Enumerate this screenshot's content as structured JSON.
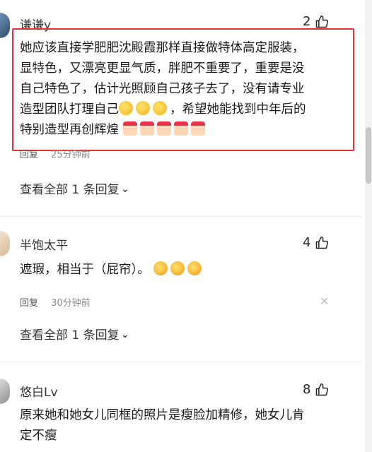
{
  "comments": [
    {
      "username": "谦谦y",
      "likes": "2",
      "text_lines": [
        "她应该直接学肥肥沈殿霞那样直接做特体高定服装，",
        "显特色，又漂亮更显气质，胖肥不重要了，重要是没",
        "自己特色了，估计光照顾自己孩子去了，没有请专业",
        "造型团队打理自己",
        "，希望她能找到中年后的",
        "特别造型再创辉煌"
      ],
      "reply_label": "回复",
      "time": "25分钟前",
      "view_all": "查看全部 1 条回复"
    },
    {
      "username": "半饱太平",
      "likes": "4",
      "text": "遮瑕，相当于（屁帘）。",
      "reply_label": "回复",
      "time": "30分钟前",
      "view_all": "查看全部 1 条回复"
    },
    {
      "username": "悠白Lv",
      "likes": "8",
      "text_lines": [
        "原来她和她女儿同框的照片是瘦脸加精修，她女儿肯",
        "定不瘦"
      ]
    }
  ],
  "icons": {
    "like": "thumbs-up-icon",
    "chevron": "chevron-down-icon",
    "close": "close-icon",
    "emoji_smirk": "smirk-emoji-icon",
    "emoji_cry": "crying-emoji-icon",
    "emoji_hand": "finger-heart-icon"
  },
  "colors": {
    "highlight_border": "#e5333a",
    "meta_text": "#8a8a8a"
  }
}
